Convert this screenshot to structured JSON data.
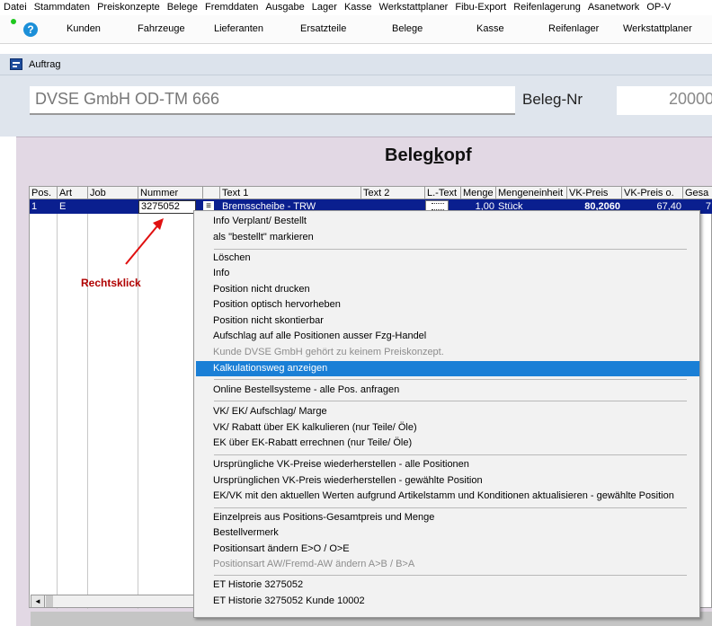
{
  "menu": [
    "Datei",
    "Stammdaten",
    "Preiskonzepte",
    "Belege",
    "Fremddaten",
    "Ausgabe",
    "Lager",
    "Kasse",
    "Werkstattplaner",
    "Fibu-Export",
    "Reifenlagerung",
    "Asanetwork",
    "OP-V"
  ],
  "toolbar": {
    "help_glyph": "?",
    "buttons": [
      "Kunden",
      "Fahrzeuge",
      "Lieferanten",
      "Ersatzteile",
      "Belege",
      "Kasse",
      "Reifenlager",
      "Werkstattplaner"
    ]
  },
  "window": {
    "title": "Auftrag"
  },
  "header": {
    "customer": "DVSE GmbH OD-TM 666",
    "beleg_label": "Beleg-Nr",
    "beleg_value": "20000"
  },
  "section_title": "Belegkopf",
  "grid": {
    "columns": [
      "Pos.",
      "Art",
      "Job",
      "Nummer",
      "",
      "Text 1",
      "Text 2",
      "L.-Text",
      "Menge",
      "Mengeneinheit",
      "VK-Preis",
      "VK-Preis o.",
      "Gesa"
    ],
    "row": {
      "pos": "1",
      "art": "E",
      "job": "",
      "nummer": "3275052",
      "bar": "≡",
      "text1": "Bremsscheibe - TRW",
      "text2": "",
      "menge": "1,00",
      "einheit": "Stück",
      "vk": "80,2060",
      "vk_o": "67,40",
      "gesa": "7"
    },
    "scroll_left": "◄"
  },
  "annotation": "Rechtsklick",
  "context_menu": {
    "items": [
      {
        "label": "Info Verplant/ Bestellt",
        "disabled": false
      },
      {
        "label": "als \"bestellt\" markieren",
        "disabled": false
      },
      {
        "label": "Löschen",
        "disabled": false
      },
      {
        "label": "Info",
        "disabled": false
      },
      {
        "label": "Position nicht drucken",
        "disabled": false
      },
      {
        "label": "Position optisch hervorheben",
        "disabled": false
      },
      {
        "label": "Position nicht skontierbar",
        "disabled": false
      },
      {
        "label": "Aufschlag auf alle Positionen ausser Fzg-Handel",
        "disabled": false
      },
      {
        "label": "Kunde DVSE GmbH gehört zu keinem Preiskonzept.",
        "disabled": true
      },
      {
        "label": "Kalkulationsweg anzeigen",
        "disabled": false,
        "highlighted": true
      },
      {
        "label": "Online Bestellsysteme - alle Pos. anfragen",
        "disabled": false
      },
      {
        "label": "VK/ EK/ Aufschlag/ Marge",
        "disabled": false
      },
      {
        "label": "VK/ Rabatt über EK kalkulieren (nur Teile/ Öle)",
        "disabled": false
      },
      {
        "label": "EK über EK-Rabatt errechnen (nur Teile/ Öle)",
        "disabled": false
      },
      {
        "label": "Ursprüngliche VK-Preise wiederherstellen - alle Positionen",
        "disabled": false
      },
      {
        "label": "Ursprünglichen VK-Preis wiederherstellen - gewählte Position",
        "disabled": false
      },
      {
        "label": "EK/VK mit den aktuellen Werten aufgrund Artikelstamm und Konditionen aktualisieren - gewählte Position",
        "disabled": false
      },
      {
        "label": "Einzelpreis aus Positions-Gesamtpreis und Menge",
        "disabled": false
      },
      {
        "label": "Bestellvermerk",
        "disabled": false
      },
      {
        "label": "Positionsart ändern E>O / O>E",
        "disabled": false
      },
      {
        "label": " Positionsart AW/Fremd-AW ändern A>B / B>A",
        "disabled": true
      },
      {
        "label": "ET Historie 3275052",
        "disabled": false
      },
      {
        "label": "ET Historie 3275052 Kunde 10002",
        "disabled": false
      }
    ]
  },
  "colors": {
    "selection": "#0a1f8f",
    "highlight": "#1a7fd6",
    "annotation": "#b00000",
    "panel": "#e2d8e4"
  }
}
